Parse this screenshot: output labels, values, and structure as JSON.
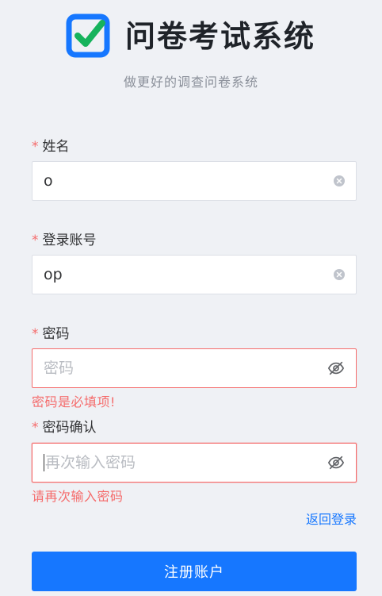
{
  "header": {
    "title": "问卷考试系统",
    "subtitle": "做更好的调查问卷系统",
    "logo_icon": "checkbox-check-icon",
    "logo_color": "#1677ff",
    "check_color": "#16b35c"
  },
  "form": {
    "required_mark": "*",
    "name": {
      "label": "姓名",
      "value": "o",
      "icon": "clear-icon"
    },
    "account": {
      "label": "登录账号",
      "value": "op",
      "icon": "clear-icon"
    },
    "password": {
      "label": "密码",
      "placeholder": "密码",
      "value": "",
      "icon": "eye-off-icon",
      "error": "密码是必填项!"
    },
    "confirm": {
      "label": "密码确认",
      "placeholder": "再次输入密码",
      "value": "",
      "icon": "eye-off-icon",
      "error": "请再次输入密码"
    },
    "back_link": "返回登录",
    "submit": "注册账户"
  },
  "colors": {
    "primary": "#1677ff",
    "error": "#f56c6c",
    "background": "#eff1f5"
  }
}
